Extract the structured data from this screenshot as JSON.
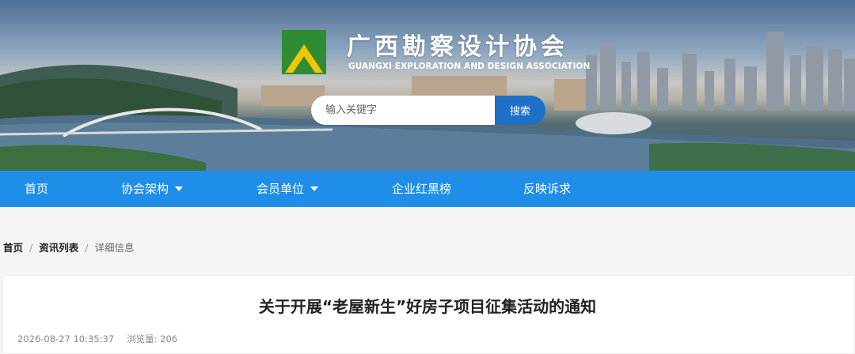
{
  "header": {
    "title": "广西勘察设计协会",
    "subtitle": "GUANGXI EXPLORATION AND DESIGN ASSOCIATION",
    "logo_icon": "triangle-logo-icon",
    "brand_green": "#2f8c34",
    "brand_yellow": "#f2c500"
  },
  "search": {
    "placeholder": "输入关键字",
    "button_label": "搜索",
    "button_color": "#1e70c7"
  },
  "nav": {
    "background": "#1e8ee8",
    "items": [
      {
        "label": "首页",
        "has_dropdown": false
      },
      {
        "label": "协会架构",
        "has_dropdown": true
      },
      {
        "label": "会员单位",
        "has_dropdown": true
      },
      {
        "label": "企业红黑榜",
        "has_dropdown": false
      },
      {
        "label": "反映诉求",
        "has_dropdown": false
      }
    ]
  },
  "breadcrumb": {
    "home": "首页",
    "list": "资讯列表",
    "current": "详细信息",
    "separator": "/"
  },
  "article": {
    "title": "关于开展“老屋新生”好房子项目征集活动的通知",
    "date": "2026-08-27 10:35:37",
    "views": "浏览量: 206"
  }
}
